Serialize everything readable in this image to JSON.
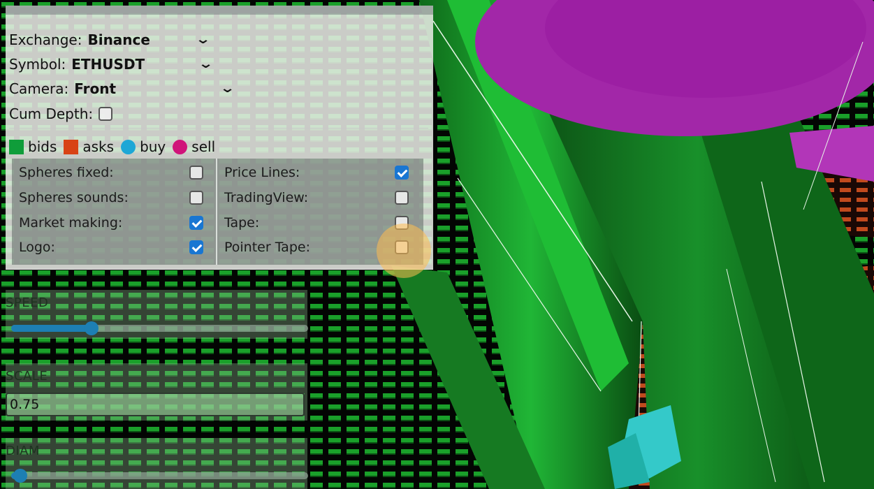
{
  "dropdowns": {
    "exchange": {
      "label": "Exchange:",
      "value": "Binance"
    },
    "symbol": {
      "label": "Symbol:",
      "value": "ETHUSDT"
    },
    "camera": {
      "label": "Camera:",
      "value": "Front"
    },
    "chevron": "⌄"
  },
  "cum_depth": {
    "label": "Cum Depth:",
    "checked": false
  },
  "legend": [
    {
      "label": "bids",
      "color": "#0f9d3a",
      "shape": "square"
    },
    {
      "label": "asks",
      "color": "#d84315",
      "shape": "square"
    },
    {
      "label": "buy",
      "color": "#1ea7d6",
      "shape": "circle"
    },
    {
      "label": "sell",
      "color": "#d0147a",
      "shape": "circle"
    }
  ],
  "options_left": [
    {
      "label": "Spheres fixed:",
      "checked": false
    },
    {
      "label": "Spheres sounds:",
      "checked": false
    },
    {
      "label": "Market making:",
      "checked": true
    },
    {
      "label": "Logo:",
      "checked": true
    }
  ],
  "options_right": [
    {
      "label": "Price Lines:",
      "checked": true
    },
    {
      "label": "TradingView:",
      "checked": false
    },
    {
      "label": "Tape:",
      "checked": false
    },
    {
      "label": "Pointer Tape:",
      "checked": false
    }
  ],
  "speed": {
    "title": "SPEED",
    "value": 0.27
  },
  "scale": {
    "title": "SCALE",
    "value": "0.75"
  },
  "diam": {
    "title": "DIAM",
    "value": 0.03
  },
  "colors": {
    "accent": "#1976d2",
    "slider": "#1d7fb3",
    "magenta": "#a227a8",
    "green": "#1aa82e"
  }
}
